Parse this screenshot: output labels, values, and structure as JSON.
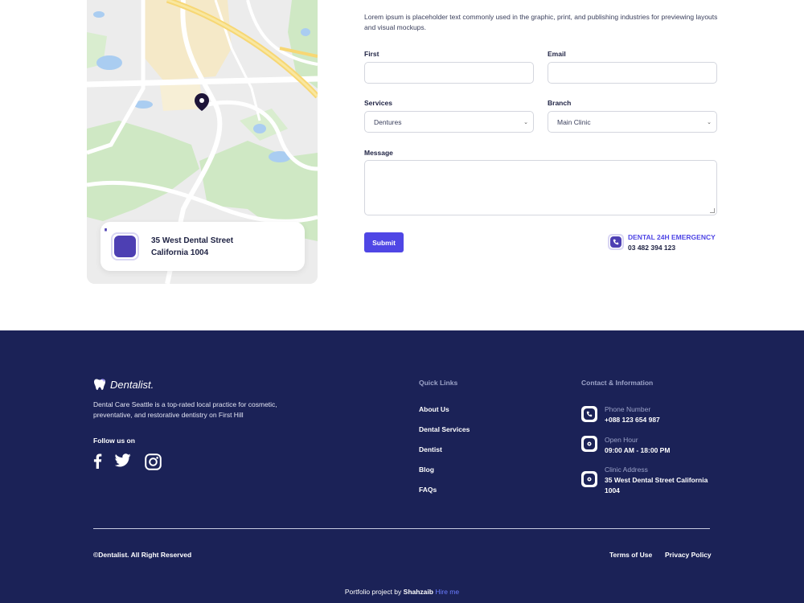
{
  "contact": {
    "intro": "Lorem ipsum is placeholder text commonly used in the graphic, print, and publishing industries for previewing layouts and visual mockups.",
    "first_label": "First",
    "email_label": "Email",
    "services_label": "Services",
    "services_value": "Dentures",
    "branch_label": "Branch",
    "branch_value": "Main Clinic",
    "message_label": "Message",
    "submit_label": "Submit",
    "emergency_title": "DENTAL 24H EMERGENCY",
    "emergency_number": "03 482 394 123",
    "map_address": "35 West Dental Street California 1004"
  },
  "footer": {
    "brand": "Dentalist.",
    "about": "Dental Care Seattle is a top-rated local practice for cosmetic, preventative, and restorative dentistry on First Hill",
    "follow": "Follow us on",
    "quick_links_title": "Quick Links",
    "quick_links": [
      "About Us",
      "Dental Services",
      "Dentist",
      "Blog",
      "FAQs"
    ],
    "contact_title": "Contact & Information",
    "phone_label": "Phone Number",
    "phone_value": "+088 123 654 987",
    "hour_label": "Open Hour",
    "hour_value": "09:00 AM - 18:00 PM",
    "address_label": "Clinic Address",
    "address_value": "35 West Dental Street California 1004",
    "copyright": "©Dentalist. All Right Reserved",
    "terms": "Terms of Use",
    "privacy": "Privacy Policy",
    "credit_prefix": "Portfolio project by",
    "credit_author": "Shahzaib",
    "credit_link": "Hire me"
  },
  "colors": {
    "accent": "#4f46e5",
    "footer_bg": "#1b2257",
    "icon_purple": "#4d3fb3"
  }
}
